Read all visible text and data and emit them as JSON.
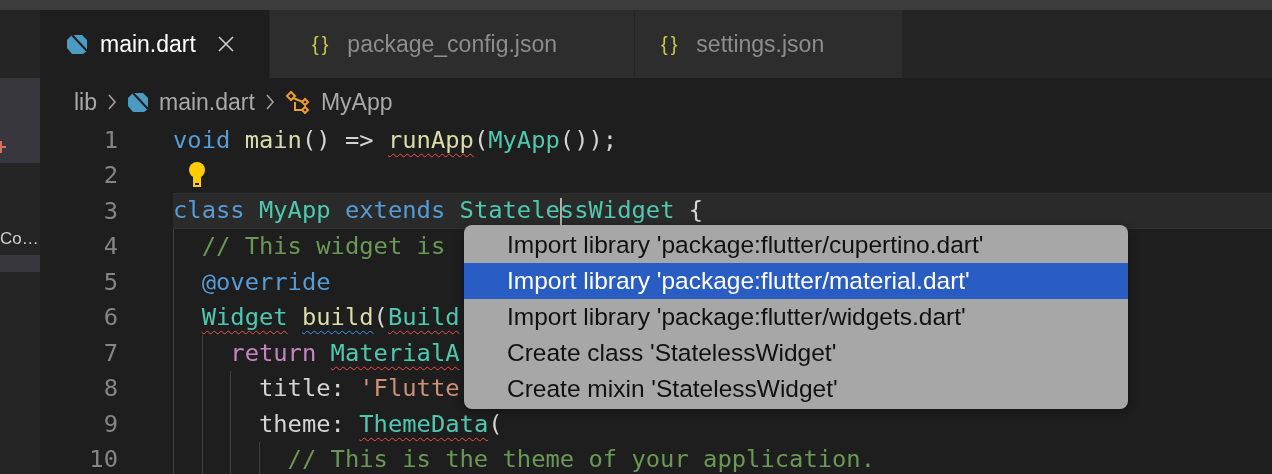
{
  "sidebar": {
    "items": [
      {
        "kind": "add",
        "selected": true
      },
      {
        "kind": "label",
        "label": "Co…",
        "selected": false
      },
      {
        "kind": "blank",
        "selected": true
      }
    ]
  },
  "tabs": [
    {
      "kind": "dart",
      "label": "main.dart",
      "selected": true
    },
    {
      "kind": "json",
      "glyph": "{}",
      "label": "package_config.json",
      "selected": false
    },
    {
      "kind": "json",
      "glyph": "{}",
      "label": "settings.json",
      "selected": false
    }
  ],
  "breadcrumbs": [
    {
      "kind": "folder",
      "label": "lib"
    },
    {
      "kind": "dart",
      "label": "main.dart"
    },
    {
      "kind": "class",
      "label": "MyApp"
    }
  ],
  "code": [
    {
      "number": "1",
      "kind": "plain",
      "tokens": [
        {
          "kind": "keyword",
          "text": "void "
        },
        {
          "kind": "function",
          "text": "main"
        },
        {
          "kind": "plain",
          "text": "() => "
        },
        {
          "kind": "function-error",
          "text": "runApp"
        },
        {
          "kind": "plain",
          "text": "("
        },
        {
          "kind": "type",
          "text": "MyApp"
        },
        {
          "kind": "plain",
          "text": "());"
        }
      ]
    },
    {
      "number": "2",
      "kind": "hint"
    },
    {
      "number": "3",
      "kind": "current",
      "tokens": [
        {
          "kind": "keyword",
          "text": "class "
        },
        {
          "kind": "type",
          "text": "MyApp "
        },
        {
          "kind": "keyword",
          "text": "extends "
        },
        {
          "kind": "type",
          "text": "Statele"
        },
        {
          "kind": "cursor"
        },
        {
          "kind": "type",
          "text": "ssWidget"
        },
        {
          "kind": "plain",
          "text": " {"
        }
      ]
    },
    {
      "number": "4",
      "kind": "plain",
      "tokens": [
        {
          "kind": "comment",
          "text": "  // This widget is"
        }
      ]
    },
    {
      "number": "5",
      "kind": "plain",
      "tokens": [
        {
          "kind": "keyword",
          "text": "  @override"
        }
      ]
    },
    {
      "number": "6",
      "kind": "plain",
      "tokens": [
        {
          "kind": "type-error",
          "text": "  Widget "
        },
        {
          "kind": "function-info",
          "text": "build"
        },
        {
          "kind": "plain",
          "text": "("
        },
        {
          "kind": "type-error",
          "text": "Build"
        }
      ]
    },
    {
      "number": "7",
      "kind": "plain",
      "tokens": [
        {
          "kind": "control",
          "text": "    return "
        },
        {
          "kind": "type-error",
          "text": "MaterialA"
        }
      ]
    },
    {
      "number": "8",
      "kind": "plain",
      "tokens": [
        {
          "kind": "plain",
          "text": "      title: "
        },
        {
          "kind": "string",
          "text": "'Flutte"
        }
      ]
    },
    {
      "number": "9",
      "kind": "plain",
      "tokens": [
        {
          "kind": "plain",
          "text": "      theme: "
        },
        {
          "kind": "type-error",
          "text": "ThemeData"
        },
        {
          "kind": "plain",
          "text": "("
        }
      ]
    },
    {
      "number": "10",
      "kind": "plain",
      "tokens": [
        {
          "kind": "comment",
          "text": "        // This is the theme of your application."
        }
      ]
    }
  ],
  "quick_fix_menu": {
    "items": [
      {
        "label": "Import library 'package:flutter/cupertino.dart'",
        "selected": false
      },
      {
        "label": "Import library 'package:flutter/material.dart'",
        "selected": true
      },
      {
        "label": "Import library 'package:flutter/widgets.dart'",
        "selected": false
      },
      {
        "label": "Create class 'StatelessWidget'",
        "selected": false
      },
      {
        "label": "Create mixin 'StatelessWidget'",
        "selected": false
      }
    ]
  }
}
